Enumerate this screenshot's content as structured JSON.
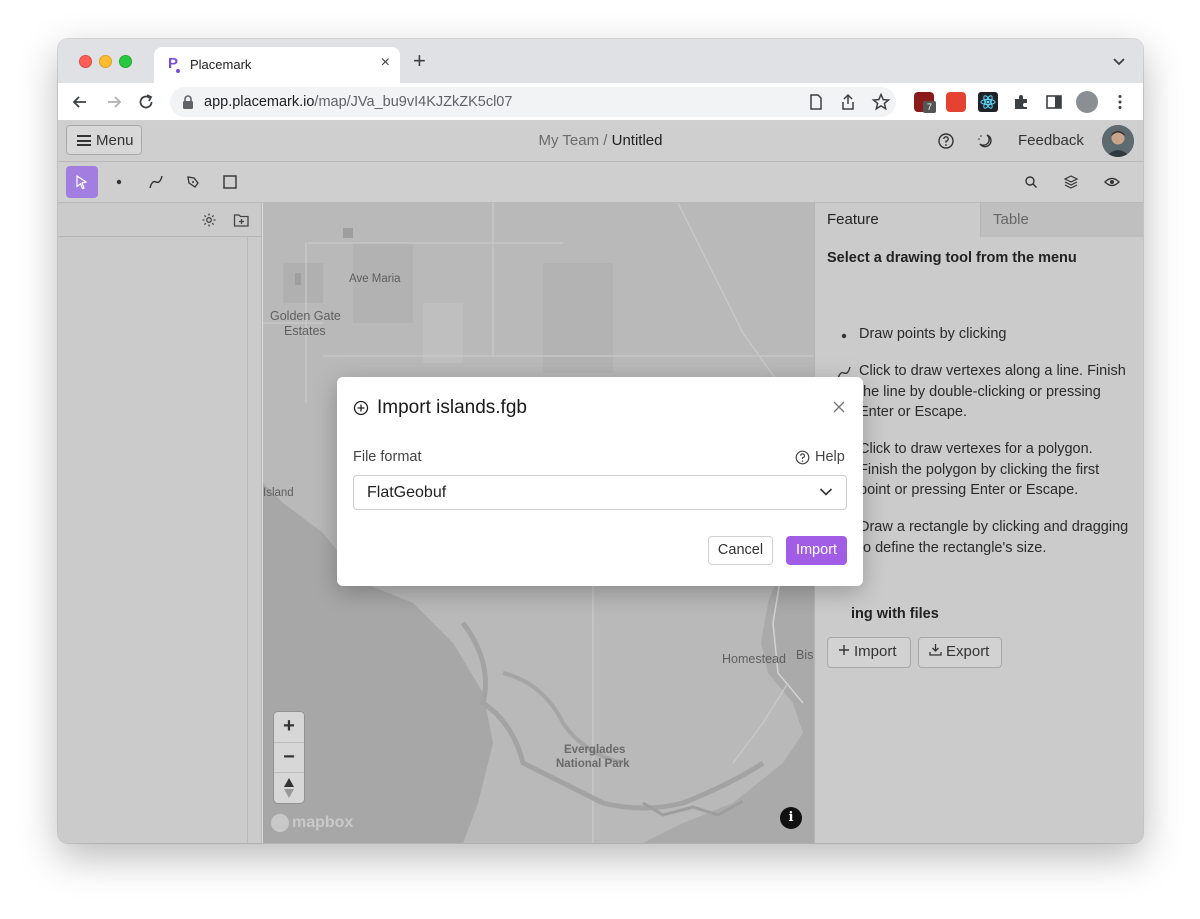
{
  "browser": {
    "tab_title": "Placemark",
    "tab_close": "×",
    "new_tab": "+",
    "url_host": "app.placemark.io",
    "url_path": "/map/JVa_bu9vI4KJZkZK5cl07",
    "ext_badge": "7"
  },
  "header": {
    "menu_label": "Menu",
    "team": "My Team",
    "separator": " / ",
    "document": "Untitled",
    "feedback": "Feedback"
  },
  "toolbar": {
    "active_tool": "select"
  },
  "map": {
    "labels": {
      "ave_maria": "Ave Maria",
      "golden_gate": "Golden Gate",
      "estates": "Estates",
      "island": "Island",
      "homestead": "Homestead",
      "bisc": "Bisc",
      "everglades": "Everglades",
      "national_park": "National Park"
    },
    "zoom_in": "+",
    "zoom_out": "−",
    "attribution_logo": "mapbox",
    "info": "i"
  },
  "panel": {
    "tab_feature": "Feature",
    "tab_table": "Table",
    "title": "Select a drawing tool from the menu",
    "items": [
      "Draw points by clicking",
      "Click to draw vertexes along a line. Finish the line by double-clicking or pressing Enter or Escape.",
      "Click to draw vertexes for a polygon. Finish the polygon by clicking the first point or pressing Enter or Escape.",
      "Draw a rectangle by clicking and dragging to define the rectangle's size."
    ],
    "files_heading": "ing with files",
    "import_label": "Import",
    "export_label": "Export"
  },
  "modal": {
    "title": "Import islands.fgb",
    "format_label": "File format",
    "help_label": "Help",
    "format_value": "FlatGeobuf",
    "cancel_label": "Cancel",
    "import_label": "Import"
  },
  "colors": {
    "accent": "#a25de6",
    "tool_active": "#a27ee0"
  }
}
